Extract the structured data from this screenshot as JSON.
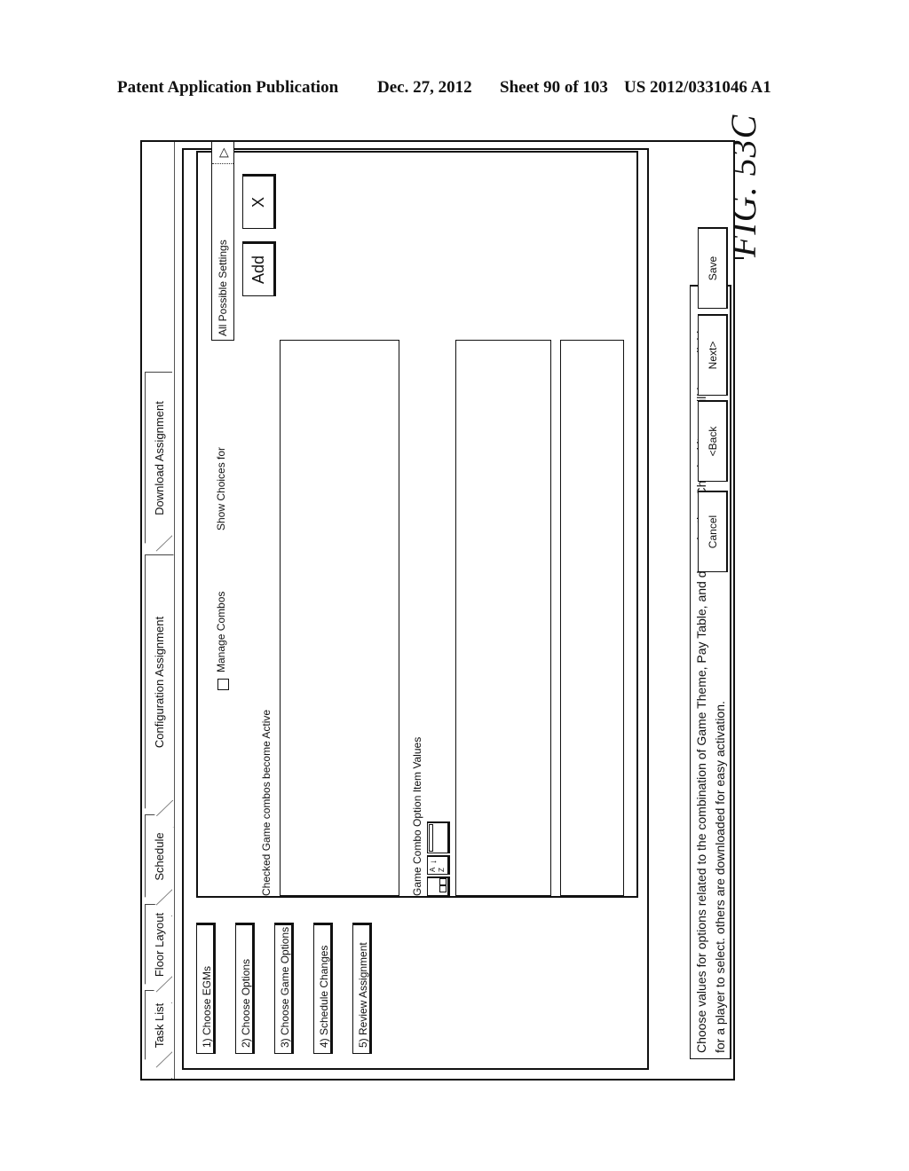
{
  "header": {
    "publication": "Patent Application Publication",
    "date": "Dec. 27, 2012",
    "sheet": "Sheet 90 of 103",
    "patent_number": "US 2012/0331046 A1"
  },
  "figure_label": "FIG. 53C",
  "tabs": [
    {
      "label": "Task List",
      "active": false
    },
    {
      "label": "Floor Layout",
      "active": false
    },
    {
      "label": "Schedule",
      "active": false
    },
    {
      "label": "Configuration Assignment",
      "active": true
    },
    {
      "label": "Download Assignment",
      "active": false
    }
  ],
  "steps": [
    {
      "label": "1) Choose EGMs"
    },
    {
      "label": "2) Choose Options"
    },
    {
      "label": "3) Choose Game Options"
    },
    {
      "label": "4) Schedule Changes"
    },
    {
      "label": "5) Review Assignment"
    }
  ],
  "panel": {
    "manage_combos_label": "Manage Combos",
    "manage_combos_checked": false,
    "show_choices_label": "Show Choices for",
    "show_choices_value": "All Possible Settings",
    "dropdown_icon": "triangle-right-icon",
    "add_label": "Add",
    "remove_label": "X",
    "active_combos_label": "Checked Game combos become Active",
    "option_values_label": "Game Combo Option Item Values",
    "toolbar_icons": [
      "checkbox-list-icon",
      "sort-a-z-icon",
      "window-icon"
    ]
  },
  "info_text_line1": "Choose values for options related to the combination of Game Theme, Pay Table, and denomination. Checked items will be available",
  "info_text_line2": "for a player to select. others are downloaded for easy activation.",
  "nav": {
    "cancel": "Cancel",
    "back": "<Back",
    "next": "Next>",
    "save": "Save"
  }
}
